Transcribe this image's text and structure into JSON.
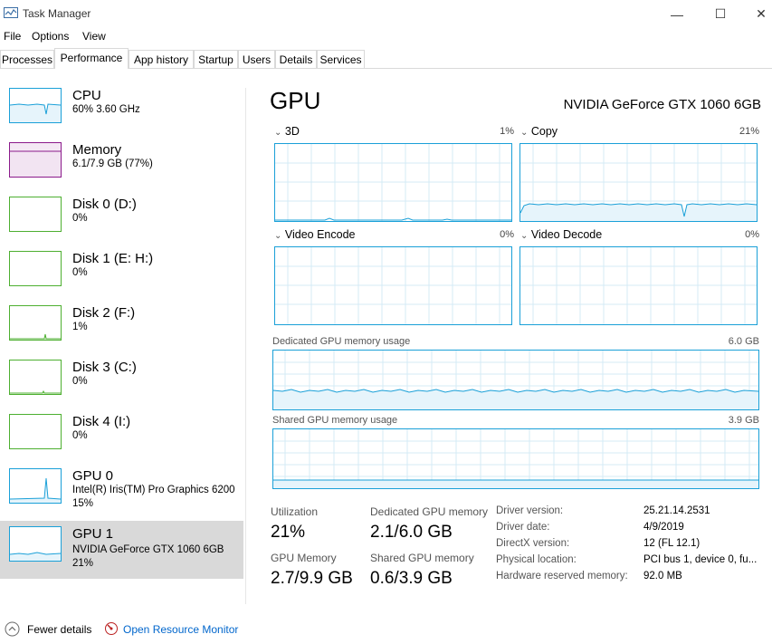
{
  "window": {
    "title": "Task Manager",
    "minimize": "—",
    "maximize": "☐",
    "close": "✕"
  },
  "menu": [
    "File",
    "Options",
    "View"
  ],
  "tabs": [
    "Processes",
    "Performance",
    "App history",
    "Startup",
    "Users",
    "Details",
    "Services"
  ],
  "active_tab": "Performance",
  "sidebar": [
    {
      "name": "CPU",
      "sub1": "60%  3.60 GHz",
      "sub2": "",
      "color": "#1aa0d8"
    },
    {
      "name": "Memory",
      "sub1": "6.1/7.9 GB (77%)",
      "sub2": "",
      "color": "#8b1a8b"
    },
    {
      "name": "Disk 0 (D:)",
      "sub1": "0%",
      "sub2": "",
      "color": "#4daf30"
    },
    {
      "name": "Disk 1 (E: H:)",
      "sub1": "0%",
      "sub2": "",
      "color": "#4daf30"
    },
    {
      "name": "Disk 2 (F:)",
      "sub1": "1%",
      "sub2": "",
      "color": "#4daf30"
    },
    {
      "name": "Disk 3 (C:)",
      "sub1": "0%",
      "sub2": "",
      "color": "#4daf30"
    },
    {
      "name": "Disk 4 (I:)",
      "sub1": "0%",
      "sub2": "",
      "color": "#4daf30"
    },
    {
      "name": "GPU 0",
      "sub1": "Intel(R) Iris(TM) Pro Graphics 6200",
      "sub2": "15%",
      "color": "#1aa0d8"
    },
    {
      "name": "GPU 1",
      "sub1": "NVIDIA GeForce GTX 1060 6GB",
      "sub2": "21%",
      "color": "#1aa0d8"
    }
  ],
  "main": {
    "title": "GPU",
    "model": "NVIDIA GeForce GTX 1060 6GB",
    "engines": [
      {
        "label": "3D",
        "pct": "1%"
      },
      {
        "label": "Copy",
        "pct": "21%"
      },
      {
        "label": "Video Encode",
        "pct": "0%"
      },
      {
        "label": "Video Decode",
        "pct": "0%"
      }
    ],
    "dedicated": {
      "label": "Dedicated GPU memory usage",
      "max": "6.0 GB"
    },
    "shared": {
      "label": "Shared GPU memory usage",
      "max": "3.9 GB"
    },
    "stats": {
      "utilization_label": "Utilization",
      "utilization": "21%",
      "dedicated_label": "Dedicated GPU memory",
      "dedicated": "2.1/6.0 GB",
      "gpu_memory_label": "GPU Memory",
      "gpu_memory": "2.7/9.9 GB",
      "shared_label": "Shared GPU memory",
      "shared": "0.6/3.9 GB"
    },
    "info": [
      {
        "label": "Driver version:",
        "value": "25.21.14.2531"
      },
      {
        "label": "Driver date:",
        "value": "4/9/2019"
      },
      {
        "label": "DirectX version:",
        "value": "12 (FL 12.1)"
      },
      {
        "label": "Physical location:",
        "value": "PCI bus 1, device 0, fu..."
      },
      {
        "label": "Hardware reserved memory:",
        "value": "92.0 MB"
      }
    ]
  },
  "footer": {
    "fewer_details": "Fewer details",
    "resource_monitor": "Open Resource Monitor"
  },
  "colors": {
    "accent": "#1aa0d8",
    "link": "#0066cc",
    "selected": "#d9d9d9"
  }
}
